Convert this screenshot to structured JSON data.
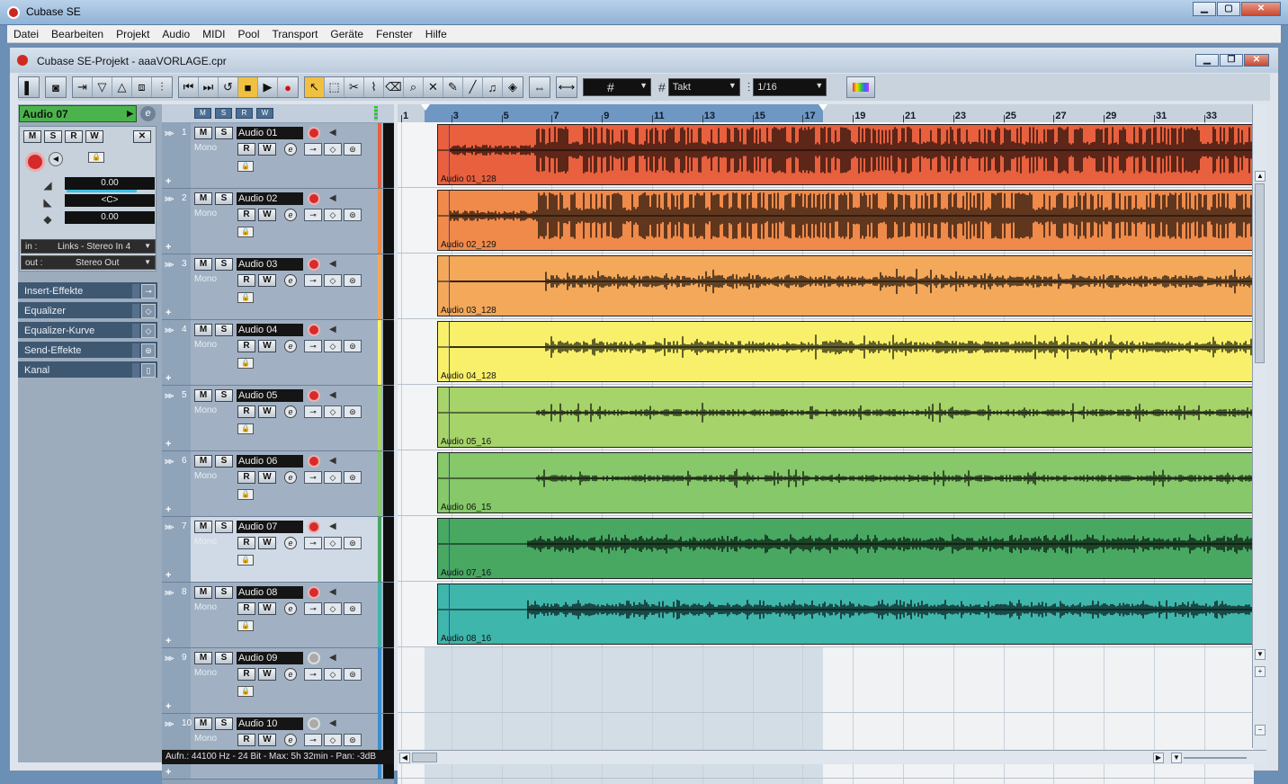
{
  "os_window": {
    "title": "Cubase SE"
  },
  "menu": [
    "Datei",
    "Bearbeiten",
    "Projekt",
    "Audio",
    "MIDI",
    "Pool",
    "Transport",
    "Geräte",
    "Fenster",
    "Hilfe"
  ],
  "project_window": {
    "title": "Cubase SE-Projekt - aaaVORLAGE.cpr"
  },
  "toolbar": {
    "snap_type": "Takt",
    "quantize": "1/16",
    "icons": {
      "transport": [
        "rewind-to-start-icon",
        "forward-to-end-icon",
        "cycle-icon",
        "stop-icon",
        "play-icon",
        "record-icon"
      ],
      "tools": [
        "object-selection-icon",
        "range-selection-icon",
        "split-icon",
        "glue-icon",
        "erase-icon",
        "zoom-icon",
        "mute-icon",
        "draw-icon",
        "line-icon",
        "play-tool-icon",
        "color-icon"
      ]
    }
  },
  "inspector": {
    "track_name": "Audio 07",
    "edit_icon": "e",
    "buttons": {
      "m": "M",
      "s": "S",
      "r": "R",
      "w": "W"
    },
    "volume": "0.00",
    "pan": "<C>",
    "delay": "0.00",
    "input_label": "in :",
    "input": "Links - Stereo In 4",
    "output_label": "out :",
    "output": "Stereo Out",
    "sections": [
      "Insert-Effekte",
      "Equalizer",
      "Equalizer-Kurve",
      "Send-Effekte",
      "Kanal"
    ]
  },
  "tracks": [
    {
      "num": "1",
      "name": "Audio 01",
      "mode": "Mono",
      "color": "#e8603e",
      "event": "Audio 01_128",
      "rec": true
    },
    {
      "num": "2",
      "name": "Audio 02",
      "mode": "Mono",
      "color": "#f08a4a",
      "event": "Audio 02_129",
      "rec": true
    },
    {
      "num": "3",
      "name": "Audio 03",
      "mode": "Mono",
      "color": "#f3a85a",
      "event": "Audio 03_128",
      "rec": true
    },
    {
      "num": "4",
      "name": "Audio 04",
      "mode": "Mono",
      "color": "#f8f06a",
      "event": "Audio 04_128",
      "rec": true
    },
    {
      "num": "5",
      "name": "Audio 05",
      "mode": "Mono",
      "color": "#a6d36a",
      "event": "Audio 05_16",
      "rec": true
    },
    {
      "num": "6",
      "name": "Audio 06",
      "mode": "Mono",
      "color": "#86c86a",
      "event": "Audio 06_15",
      "rec": true
    },
    {
      "num": "7",
      "name": "Audio 07",
      "mode": "Mono",
      "color": "#48a862",
      "event": "Audio 07_16",
      "rec": true,
      "selected": true
    },
    {
      "num": "8",
      "name": "Audio 08",
      "mode": "Mono",
      "color": "#3fb6ab",
      "event": "Audio 08_16",
      "rec": true
    },
    {
      "num": "9",
      "name": "Audio 09",
      "mode": "Mono",
      "color": "#3a8ed0",
      "rec": false
    },
    {
      "num": "10",
      "name": "Audio 10",
      "mode": "Mono",
      "color": "#3a8ed0",
      "rec": false
    }
  ],
  "ruler": [
    "1",
    "3",
    "5",
    "7",
    "9",
    "11",
    "13",
    "15",
    "17",
    "19",
    "21",
    "23",
    "25",
    "27",
    "29",
    "31",
    "33"
  ],
  "status": "Aufn.: 44100 Hz - 24 Bit - Max: 5h 32min - Pan: -3dB"
}
